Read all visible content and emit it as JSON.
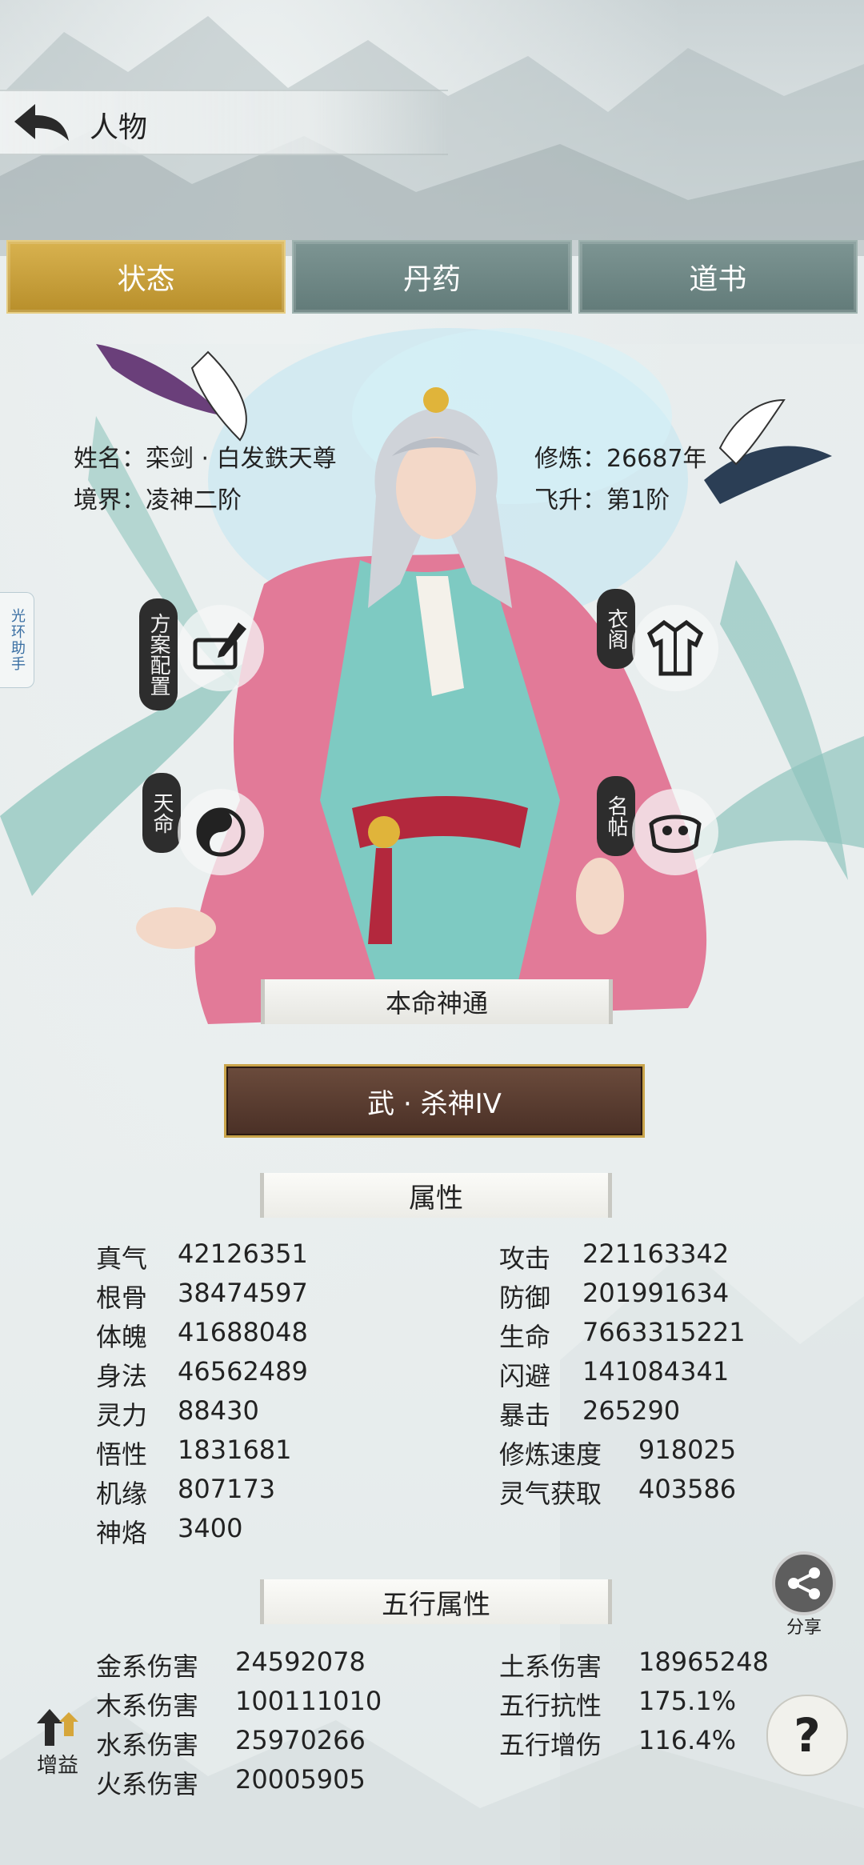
{
  "header": {
    "title": "人物"
  },
  "tabs": [
    {
      "label": "状态",
      "active": true
    },
    {
      "label": "丹药",
      "active": false
    },
    {
      "label": "道书",
      "active": false
    }
  ],
  "character": {
    "name_label": "姓名：",
    "name": "栾剑 · 白发鉄天尊",
    "cultivation_label": "修炼：",
    "cultivation": "26687年",
    "realm_label": "境界：",
    "realm": "凌神二阶",
    "ascend_label": "飞升：",
    "ascend": "第1阶"
  },
  "side_tab": {
    "label": "光环助手"
  },
  "circle_buttons": {
    "plan": "方案配置",
    "wardrobe": "衣阁",
    "fate": "天命",
    "card": "名帖"
  },
  "natal_skill": {
    "title": "本命神通",
    "skill": "武 · 杀神IV"
  },
  "attributes": {
    "title": "属性",
    "left": [
      {
        "k": "真气",
        "v": "42126351"
      },
      {
        "k": "根骨",
        "v": "38474597"
      },
      {
        "k": "体魄",
        "v": "41688048"
      },
      {
        "k": "身法",
        "v": "46562489"
      },
      {
        "k": "灵力",
        "v": "88430"
      },
      {
        "k": "悟性",
        "v": "1831681"
      },
      {
        "k": "机缘",
        "v": "807173"
      },
      {
        "k": "神烙",
        "v": "3400"
      }
    ],
    "right": [
      {
        "k": "攻击",
        "v": "221163342"
      },
      {
        "k": "防御",
        "v": "201991634"
      },
      {
        "k": "生命",
        "v": "7663315221"
      },
      {
        "k": "闪避",
        "v": "141084341"
      },
      {
        "k": "暴击",
        "v": "265290"
      },
      {
        "k": "修炼速度",
        "v": "918025"
      },
      {
        "k": "灵气获取",
        "v": "403586"
      }
    ]
  },
  "elements": {
    "title": "五行属性",
    "left": [
      {
        "k": "金系伤害",
        "v": "24592078"
      },
      {
        "k": "木系伤害",
        "v": "100111010"
      },
      {
        "k": "水系伤害",
        "v": "25970266"
      },
      {
        "k": "火系伤害",
        "v": "20005905"
      }
    ],
    "right": [
      {
        "k": "土系伤害",
        "v": "18965248"
      },
      {
        "k": "五行抗性",
        "v": "175.1%"
      },
      {
        "k": "五行增伤",
        "v": "116.4%"
      }
    ]
  },
  "buttons": {
    "share": "分享",
    "help": "?",
    "buff": "增益"
  }
}
